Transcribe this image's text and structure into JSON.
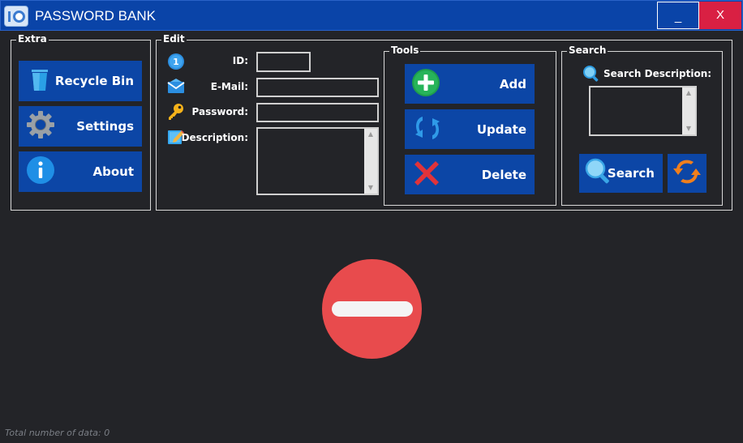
{
  "window": {
    "title": "PASSWORD BANK",
    "minimize_label": "_",
    "close_label": "X"
  },
  "extra": {
    "title": "Extra",
    "buttons": [
      {
        "label": "Recycle Bin",
        "icon": "recycle-bin-icon"
      },
      {
        "label": "Settings",
        "icon": "gear-icon"
      },
      {
        "label": "About",
        "icon": "info-icon"
      }
    ]
  },
  "edit": {
    "title": "Edit",
    "fields": {
      "id": {
        "label": "ID:",
        "icon": "number-one-icon",
        "value": ""
      },
      "email": {
        "label": "E-Mail:",
        "icon": "envelope-icon",
        "value": ""
      },
      "password": {
        "label": "Password:",
        "icon": "key-icon",
        "value": ""
      },
      "description": {
        "label": "Description:",
        "icon": "notepad-pencil-icon",
        "value": ""
      }
    }
  },
  "tools": {
    "title": "Tools",
    "buttons": [
      {
        "label": "Add",
        "icon": "plus-circle-icon"
      },
      {
        "label": "Update",
        "icon": "refresh-arrows-icon"
      },
      {
        "label": "Delete",
        "icon": "red-x-icon"
      }
    ]
  },
  "search": {
    "title": "Search",
    "description_label": "Search Description:",
    "description_value": "",
    "search_label": "Search",
    "refresh_icon": "orange-refresh-icon"
  },
  "main": {
    "placeholder_icon": "no-entry-icon"
  },
  "status": {
    "text": "Total number of data: 0"
  },
  "colors": {
    "background": "#232428",
    "titlebar": "#0a44a8",
    "button_blue": "#0c46a6",
    "close_red": "#d92043",
    "no_entry_red": "#e84b4d"
  }
}
